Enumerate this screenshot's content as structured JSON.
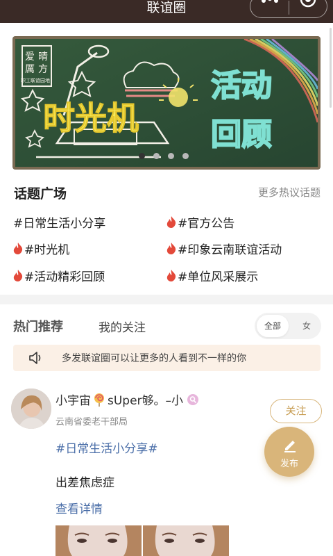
{
  "header": {
    "title": "联谊圈",
    "menu_icon": "more-dots-icon",
    "close_icon": "target-icon"
  },
  "banner": {
    "logo_lines": [
      "爱",
      "晴",
      "厲",
      "方"
    ],
    "logo_sub": "职工联谊园地",
    "headline_left": "时光机",
    "headline_right_1": "活动",
    "headline_right_2": "回顾",
    "slide_count": 4,
    "active_slide": 1
  },
  "topics": {
    "title": "话题广场",
    "more_label": "更多热议话题",
    "items": [
      {
        "label": "#日常生活小分享",
        "hot": false
      },
      {
        "label": "#官方公告",
        "hot": true
      },
      {
        "label": "#时光机",
        "hot": true
      },
      {
        "label": "#印象云南联谊活动",
        "hot": true
      },
      {
        "label": "#活动精彩回顾",
        "hot": true
      },
      {
        "label": "#单位风采展示",
        "hot": true
      }
    ]
  },
  "feed_tabs": {
    "hot_label": "热门推荐",
    "follow_label": "我的关注",
    "filter_all": "全部",
    "filter_female": "女"
  },
  "notice": {
    "icon": "speaker-icon",
    "text": "多发联谊圈可以让更多的人看到不一样的你"
  },
  "post": {
    "username": "小宇宙",
    "username_suffix": "sUper够。–小",
    "organization": "云南省委老干部局",
    "follow_label": "关注",
    "tag": "#日常生活小分享#",
    "title": "出差焦虑症",
    "details_label": "查看详情"
  },
  "fab": {
    "label": "发布",
    "icon": "pen-icon"
  },
  "colors": {
    "nav_bg": "#3a2a26",
    "accent_gold": "#d9b57a",
    "link_blue": "#4a6ea8",
    "flame_red": "#e3493a",
    "notice_bg": "#fbf0e6"
  }
}
